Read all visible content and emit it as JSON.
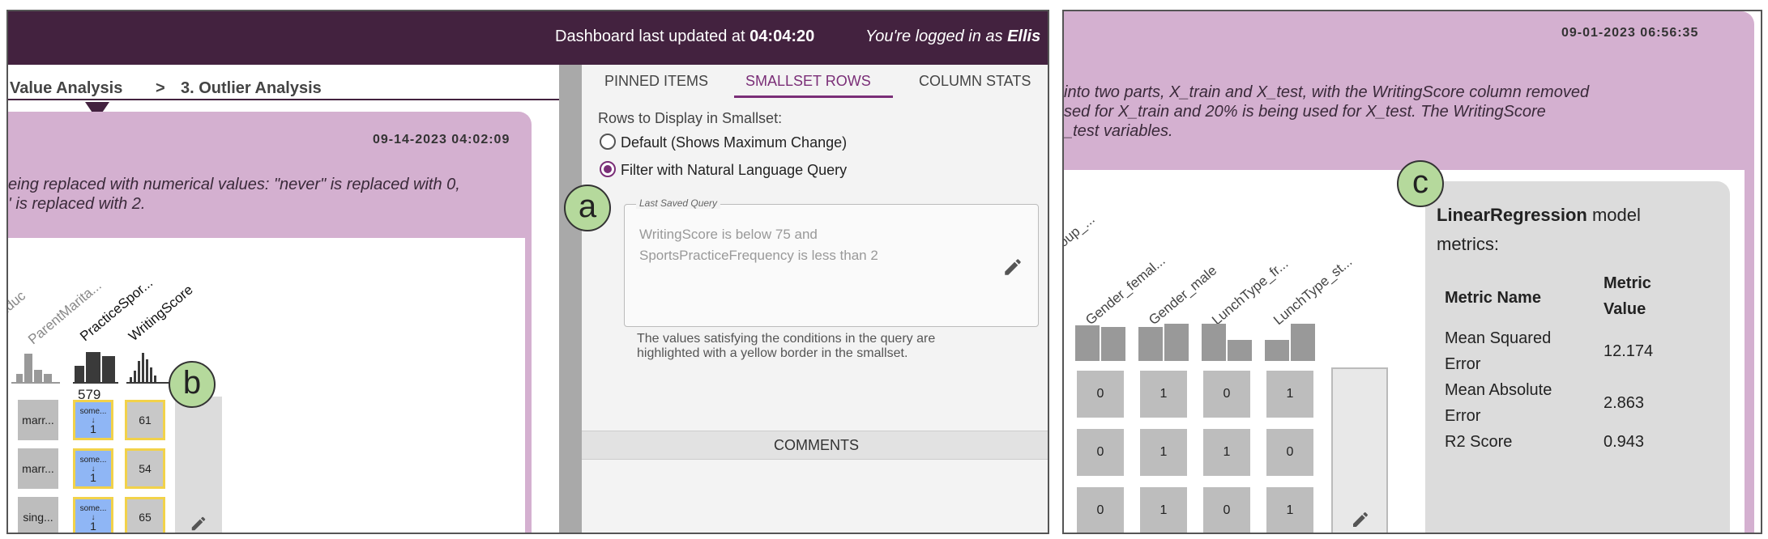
{
  "left": {
    "header": {
      "updated_prefix": "Dashboard last updated at ",
      "updated_time": "04:04:20",
      "login_prefix": "You're logged in as ",
      "login_user": "Ellis"
    },
    "breadcrumb": {
      "prev": "Value Analysis",
      "separator": ">",
      "current": "3. Outlier Analysis"
    },
    "card": {
      "timestamp": "09-14-2023 04:02:09",
      "desc_line1": "eing replaced with numerical values: \"never\" is replaced with 0,",
      "desc_line2": "' is replaced with 2."
    },
    "columns": [
      "Educ",
      "ParentMarita...",
      "PracticeSpor...",
      "WritingScore"
    ],
    "count_label": "579",
    "rows": [
      {
        "marital": "marr...",
        "practice_top": "some...",
        "practice_val": "1",
        "score": "61"
      },
      {
        "marital": "marr...",
        "practice_top": "some...",
        "practice_val": "1",
        "score": "54"
      },
      {
        "marital": "sing...",
        "practice_top": "some...",
        "practice_val": "1",
        "score": "65"
      }
    ]
  },
  "side_panel": {
    "tabs": [
      "PINNED ITEMS",
      "SMALLSET ROWS",
      "COLUMN STATS"
    ],
    "active_tab": "SMALLSET ROWS",
    "section_title": "Rows to Display in Smallset:",
    "option_default": "Default (Shows Maximum Change)",
    "option_filter": "Filter with Natural Language Query",
    "selected_option": "Filter with Natural Language Query",
    "query_legend": "Last Saved Query",
    "query_line1": "WritingScore is below 75 and",
    "query_line2": "SportsPracticeFrequency is less than 2",
    "hint_line1": "The values satisfying the conditions in the query are",
    "hint_line2": "highlighted with a yellow border in the smallset.",
    "comments_label": "COMMENTS"
  },
  "callouts": {
    "a": "a",
    "b": "b",
    "c": "c"
  },
  "right": {
    "timestamp": "09-01-2023 06:56:35",
    "desc_line1": "into two parts, X_train and X_test, with the WritingScore column removed",
    "desc_line2": "sed for X_train and 20% is being used for X_test. The WritingScore",
    "desc_line3": "_test variables.",
    "columns": [
      "Group_...",
      "Gender_femal...",
      "Gender_male",
      "LunchType_fr...",
      "LunchType_st..."
    ],
    "grid": [
      [
        "0",
        "1",
        "0",
        "1"
      ],
      [
        "0",
        "1",
        "1",
        "0"
      ],
      [
        "0",
        "1",
        "0",
        "1"
      ]
    ],
    "metrics": {
      "model_name": "LinearRegression",
      "title_rest": " model",
      "title_line2": "metrics:",
      "header_name": "Metric Name",
      "header_value_line1": "Metric",
      "header_value_line2": "Value",
      "rows": [
        {
          "name_line1": "Mean Squared",
          "name_line2": "Error",
          "value": "12.174"
        },
        {
          "name_line1": "Mean Absolute",
          "name_line2": "Error",
          "value": "2.863"
        },
        {
          "name_line1": "R2 Score",
          "name_line2": "",
          "value": "0.943"
        }
      ]
    }
  },
  "colors": {
    "header_bg": "#43223f",
    "card_bg": "#d4b0d0",
    "accent": "#7a2e77",
    "highlight_border": "#f2d24a",
    "selected_cell": "#8fb6f5",
    "callout_bg": "#b5d99c"
  }
}
